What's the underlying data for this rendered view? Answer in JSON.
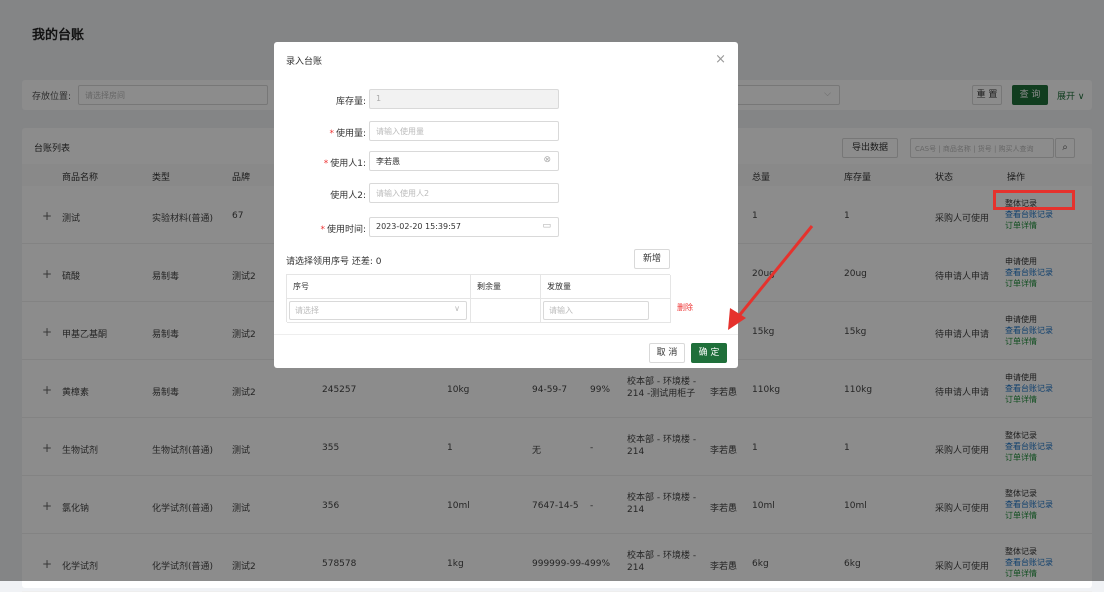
{
  "page": {
    "title": "我的台账"
  },
  "filter": {
    "location_label": "存放位置:",
    "location_placeholder": "请选择房间",
    "reset_label": "重 置",
    "query_label": "查 询",
    "expand_label": "展开",
    "expand_icon": "chevron-down"
  },
  "list": {
    "title": "台账列表",
    "export_label": "导出数据",
    "search_placeholder": "CAS号 | 商品名称 | 货号 | 购买人查询",
    "columns": {
      "name": "商品名称",
      "type": "类型",
      "brand": "品牌",
      "total": "总量",
      "stock": "库存量",
      "status": "状态",
      "ops": "操作"
    },
    "rows": [
      {
        "name": "测试",
        "type": "实验材料(普通)",
        "brand": "67",
        "code": "",
        "spec": "",
        "cas": "",
        "purity": "",
        "loc": "",
        "user": "",
        "total": "1",
        "stock": "1",
        "status": "采购人可使用",
        "actions": [
          "整体记录",
          "查看台账记录",
          "订单详情"
        ]
      },
      {
        "name": "硫酸",
        "type": "易制毒",
        "brand": "测试2",
        "code": "",
        "spec": "",
        "cas": "",
        "purity": "",
        "loc": "",
        "user": "",
        "total": "20ug",
        "stock": "20ug",
        "status": "待申请人申请",
        "actions": [
          "申请使用",
          "查看台账记录",
          "订单详情"
        ]
      },
      {
        "name": "甲基乙基酮",
        "type": "易制毒",
        "brand": "测试2",
        "code": "",
        "spec": "",
        "cas": "",
        "purity": "",
        "loc": "",
        "user": "",
        "total": "15kg",
        "stock": "15kg",
        "status": "待申请人申请",
        "actions": [
          "申请使用",
          "查看台账记录",
          "订单详情"
        ]
      },
      {
        "name": "黄樟素",
        "type": "易制毒",
        "brand": "测试2",
        "code": "245257",
        "spec": "10kg",
        "cas": "94-59-7",
        "purity": "99%",
        "loc": "校本部 - 环境楼 - 214 -测试用柜子",
        "user": "李若愚",
        "total": "110kg",
        "stock": "110kg",
        "status": "待申请人申请",
        "actions": [
          "申请使用",
          "查看台账记录",
          "订单详情"
        ]
      },
      {
        "name": "生物试剂",
        "type": "生物试剂(普通)",
        "brand": "测试",
        "code": "355",
        "spec": "1",
        "cas": "无",
        "purity": "-",
        "loc": "校本部 - 环境楼 - 214",
        "user": "李若愚",
        "total": "1",
        "stock": "1",
        "status": "采购人可使用",
        "actions": [
          "整体记录",
          "查看台账记录",
          "订单详情"
        ]
      },
      {
        "name": "氯化钠",
        "type": "化学试剂(普通)",
        "brand": "测试",
        "code": "356",
        "spec": "10ml",
        "cas": "7647-14-5",
        "purity": "-",
        "loc": "校本部 - 环境楼 - 214",
        "user": "李若愚",
        "total": "10ml",
        "stock": "10ml",
        "status": "采购人可使用",
        "actions": [
          "整体记录",
          "查看台账记录",
          "订单详情"
        ]
      },
      {
        "name": "化学试剂",
        "type": "化学试剂(普通)",
        "brand": "测试2",
        "code": "578578",
        "spec": "1kg",
        "cas": "999999-99-4",
        "purity": "99%",
        "loc": "校本部 - 环境楼 - 214",
        "user": "李若愚",
        "total": "6kg",
        "stock": "6kg",
        "status": "采购人可使用",
        "actions": [
          "整体记录",
          "查看台账记录",
          "订单详情"
        ]
      }
    ]
  },
  "dialog": {
    "title": "录入台账",
    "close_icon": "close",
    "stock_label": "库存量:",
    "stock_value": "1",
    "usage_label": "使用量:",
    "usage_placeholder": "请输入使用量",
    "user1_label": "使用人1:",
    "user1_value": "李若愚",
    "user2_label": "使用人2:",
    "user2_placeholder": "请输入使用人2",
    "time_label": "使用时间:",
    "time_value": "2023-02-20 15:39:57",
    "pick_label": "请选择领用序号 还差: 0",
    "add_label": "新增",
    "sub_columns": {
      "serial": "序号",
      "remaining": "剩余量",
      "issue": "发放量"
    },
    "serial_placeholder": "请选择",
    "issue_placeholder": "请输入",
    "delete_label": "删除",
    "cancel_label": "取 消",
    "confirm_label": "确 定"
  },
  "colors": {
    "primary": "#1f6f3a",
    "link_blue": "#1a73c7",
    "danger": "#e33",
    "highlight_red": "#e5322d"
  }
}
